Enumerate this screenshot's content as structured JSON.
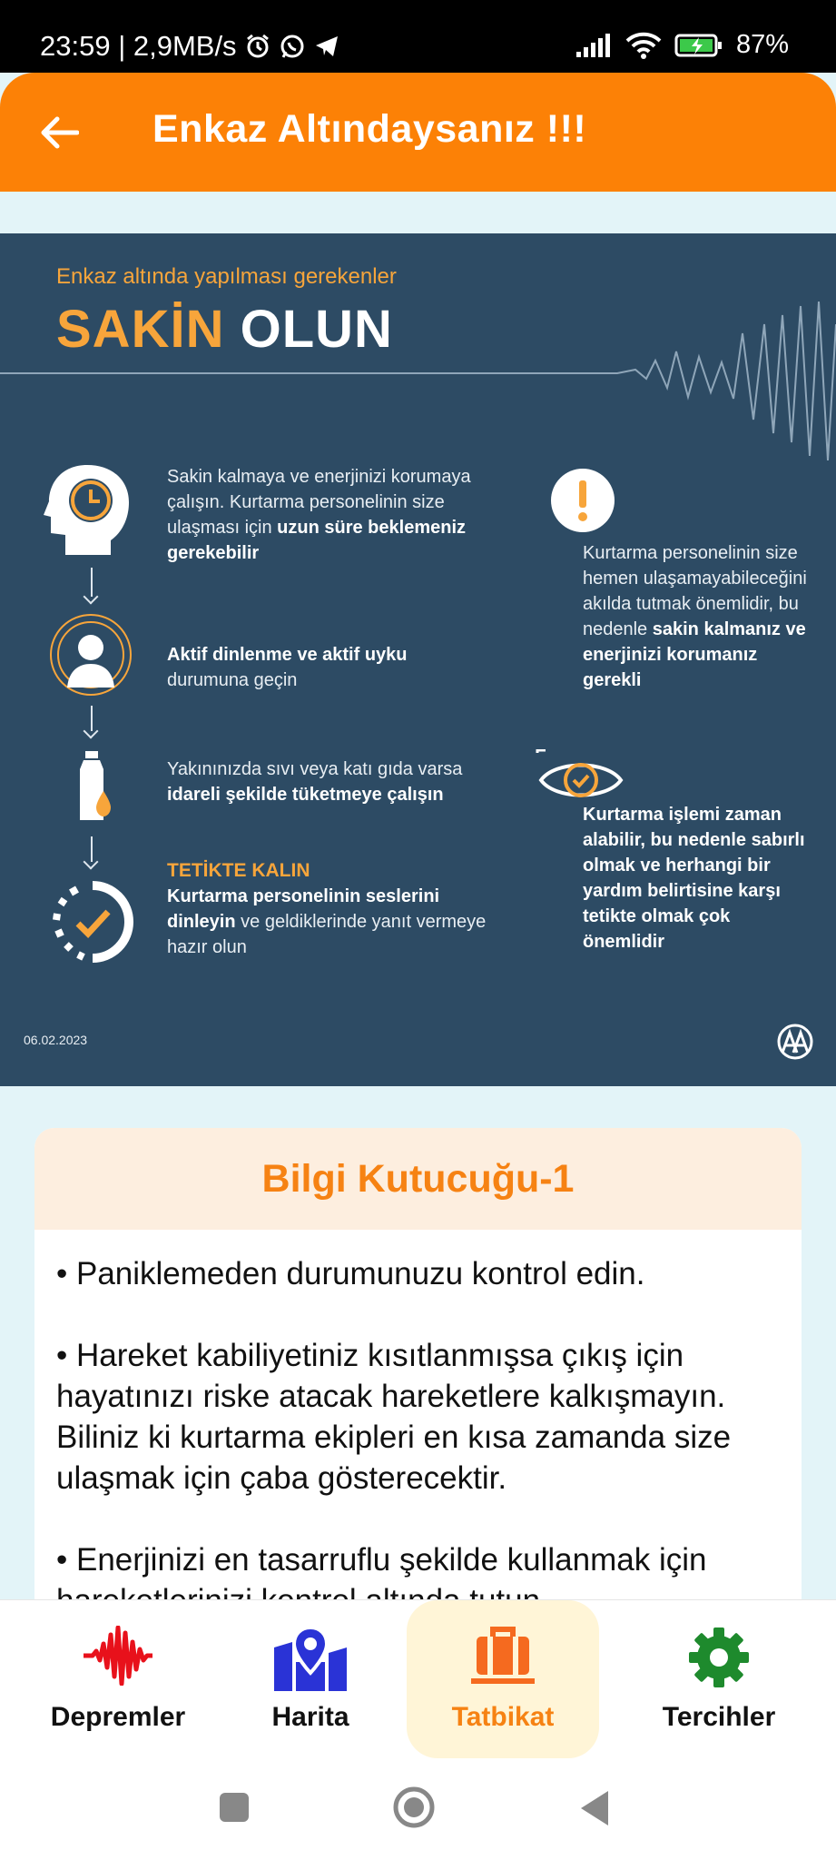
{
  "status_bar": {
    "time_speed": "23:59 | 2,9MB/s",
    "battery": "87%"
  },
  "app_bar": {
    "title": "Enkaz Altındaysanız !!!"
  },
  "infographic": {
    "subtitle": "Enkaz altında yapılması gerekenler",
    "title_part1": "SAKİN",
    "title_part2": "OLUN",
    "step1_text1": "Sakin kalmaya ve enerjinizi korumaya çalışın. Kurtarma personelinin size ulaşması için",
    "step1_bold": "uzun süre beklemeniz gerekebilir",
    "step2_bold": "Aktif dinlenme ve aktif uyku",
    "step2_text": "durumuna geçin",
    "step3_text": "Yakınınızda sıvı veya katı gıda varsa",
    "step3_bold": "idareli şekilde tüketmeye çalışın",
    "step4_heading": "TETİKTE KALIN",
    "step4_bold": "Kurtarma personelinin seslerini dinleyin",
    "step4_text": "ve geldiklerinde yanıt vermeye hazır olun",
    "right1_text": "Kurtarma personelinin size hemen ulaşamayabileceğini akılda tutmak önemlidir, bu nedenle",
    "right1_bold": "sakin kalmanız ve enerjinizi korumanız gerekli",
    "right2_bold": "Kurtarma işlemi zaman alabilir, bu nedenle sabırlı olmak ve herhangi bir yardım belirtisine karşı tetikte olmak çok önemlidir",
    "date": "06.02.2023"
  },
  "info_card": {
    "title": "Bilgi Kutucuğu-1",
    "paragraphs": [
      "• Paniklemeden durumunuzu kontrol edin.",
      "• Hareket kabiliyetiniz kısıtlanmışsa çıkış için hayatınızı riske atacak hareketlere kalkışmayın. Biliniz ki kurtarma ekipleri en kısa zamanda size ulaşmak için çaba gösterecektir.",
      "• Enerjinizi en tasarruflu şekilde kullanmak için hareketlerinizi kontrol altında tutun."
    ]
  },
  "bottom_nav": {
    "items": [
      {
        "label": "Depremler",
        "icon": "seismic-wave-icon",
        "color": "#e8111b"
      },
      {
        "label": "Harita",
        "icon": "map-pin-icon",
        "color": "#2a33d6"
      },
      {
        "label": "Tatbikat",
        "icon": "briefcase-icon",
        "color": "#f56a1f"
      },
      {
        "label": "Tercihler",
        "icon": "gear-icon",
        "color": "#1e8a2d"
      }
    ],
    "active": "Tatbikat"
  },
  "colors": {
    "accent": "#fc8106",
    "infographic_bg": "#2d4b64",
    "infographic_accent": "#f7a53b",
    "page_bg": "#e3f4f8"
  }
}
